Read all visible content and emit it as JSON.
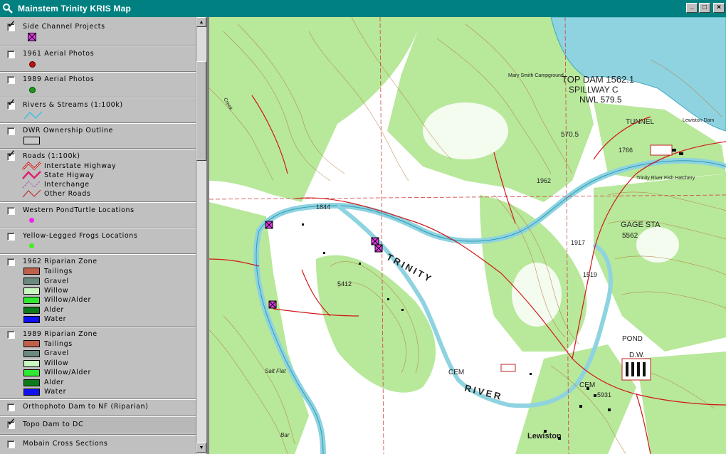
{
  "window": {
    "title": "Mainstem Trinity KRIS Map",
    "minimize": "_",
    "maximize": "□",
    "close": "×"
  },
  "colors": {
    "titlebar": "#008080",
    "map_green": "#b8e89a",
    "river": "#8fd3e0",
    "project_marker": "#e23ae6"
  },
  "legend": {
    "layers": [
      {
        "id": "side-channel",
        "label": "Side Channel Projects",
        "checked": true,
        "symbol": "magenta-x-square"
      },
      {
        "id": "aerial-1961",
        "label": "1961 Aerial Photos",
        "checked": false,
        "symbol": "red-dot"
      },
      {
        "id": "aerial-1989",
        "label": "1989 Aerial Photos",
        "checked": false,
        "symbol": "green-dot"
      },
      {
        "id": "rivers",
        "label": "Rivers & Streams (1:100k)",
        "checked": true,
        "symbol": "cyan-line"
      },
      {
        "id": "dwr-ownership",
        "label": "DWR Ownership Outline",
        "checked": false,
        "symbol": "gray-rect"
      },
      {
        "id": "roads",
        "label": "Roads (1:100k)",
        "checked": true,
        "symbol": "road-lines",
        "items": [
          "Interstate Highway",
          "State Higway",
          "Interchange",
          "Other Roads"
        ]
      },
      {
        "id": "pondturtle",
        "label": "Western PondTurtle Locations",
        "checked": false,
        "symbol": "magenta-dot"
      },
      {
        "id": "frogs",
        "label": "Yellow-Legged Frogs Locations",
        "checked": false,
        "symbol": "lime-dot"
      },
      {
        "id": "riparian-1962",
        "label": "1962 Riparian Zone",
        "checked": false,
        "items": [
          {
            "label": "Tailings",
            "color": "#c0604a"
          },
          {
            "label": "Gravel",
            "color": "#6a8a80"
          },
          {
            "label": "Willow",
            "color": "#c8f8c0"
          },
          {
            "label": "Willow/Alder",
            "color": "#30e830"
          },
          {
            "label": "Alder",
            "color": "#0a7a1a"
          },
          {
            "label": "Water",
            "color": "#1010f0"
          }
        ]
      },
      {
        "id": "riparian-1989",
        "label": "1989 Riparian Zone",
        "checked": false,
        "items": [
          {
            "label": "Tailings",
            "color": "#c0604a"
          },
          {
            "label": "Gravel",
            "color": "#6a8a80"
          },
          {
            "label": "Willow",
            "color": "#c8f8c0"
          },
          {
            "label": "Willow/Alder",
            "color": "#30e830"
          },
          {
            "label": "Alder",
            "color": "#0a7a1a"
          },
          {
            "label": "Water",
            "color": "#1010f0"
          }
        ]
      },
      {
        "id": "orthophoto",
        "label": "Orthophoto Dam to NF (Riparian)",
        "checked": false
      },
      {
        "id": "topo",
        "label": "Topo Dam to DC",
        "checked": true
      },
      {
        "id": "mobain",
        "label": "Mobain Cross Sections",
        "checked": false
      }
    ]
  },
  "map": {
    "labels": {
      "top_dam": "TOP DAM 1562.1",
      "spillway": "SPILLWAY C",
      "nwl": "NWL 579.5",
      "campground": "Mary Smith Campground",
      "lewiston_dam": "Lewiston Dam",
      "tunnel": "TUNNEL",
      "hatchery": "Trinity River Fish Hatchery",
      "gage": "GAGE STA",
      "trinity": "TRINITY",
      "river": "RIVER",
      "lewiston": "Lewiston",
      "cem1": "CEM",
      "cem2": "CEM",
      "salt_flat": "Salt Flat",
      "pond": "POND",
      "dw": "D.W.",
      "creek": "Creek",
      "bar": "Bar",
      "elev_1": "570.5",
      "elev_2": "1962",
      "elev_3": "5562",
      "elev_4": "1917",
      "elev_5": "1519",
      "elev_6": "5931",
      "elev_7": "5412",
      "elev_8": "1844",
      "elev_9": "1766"
    }
  }
}
